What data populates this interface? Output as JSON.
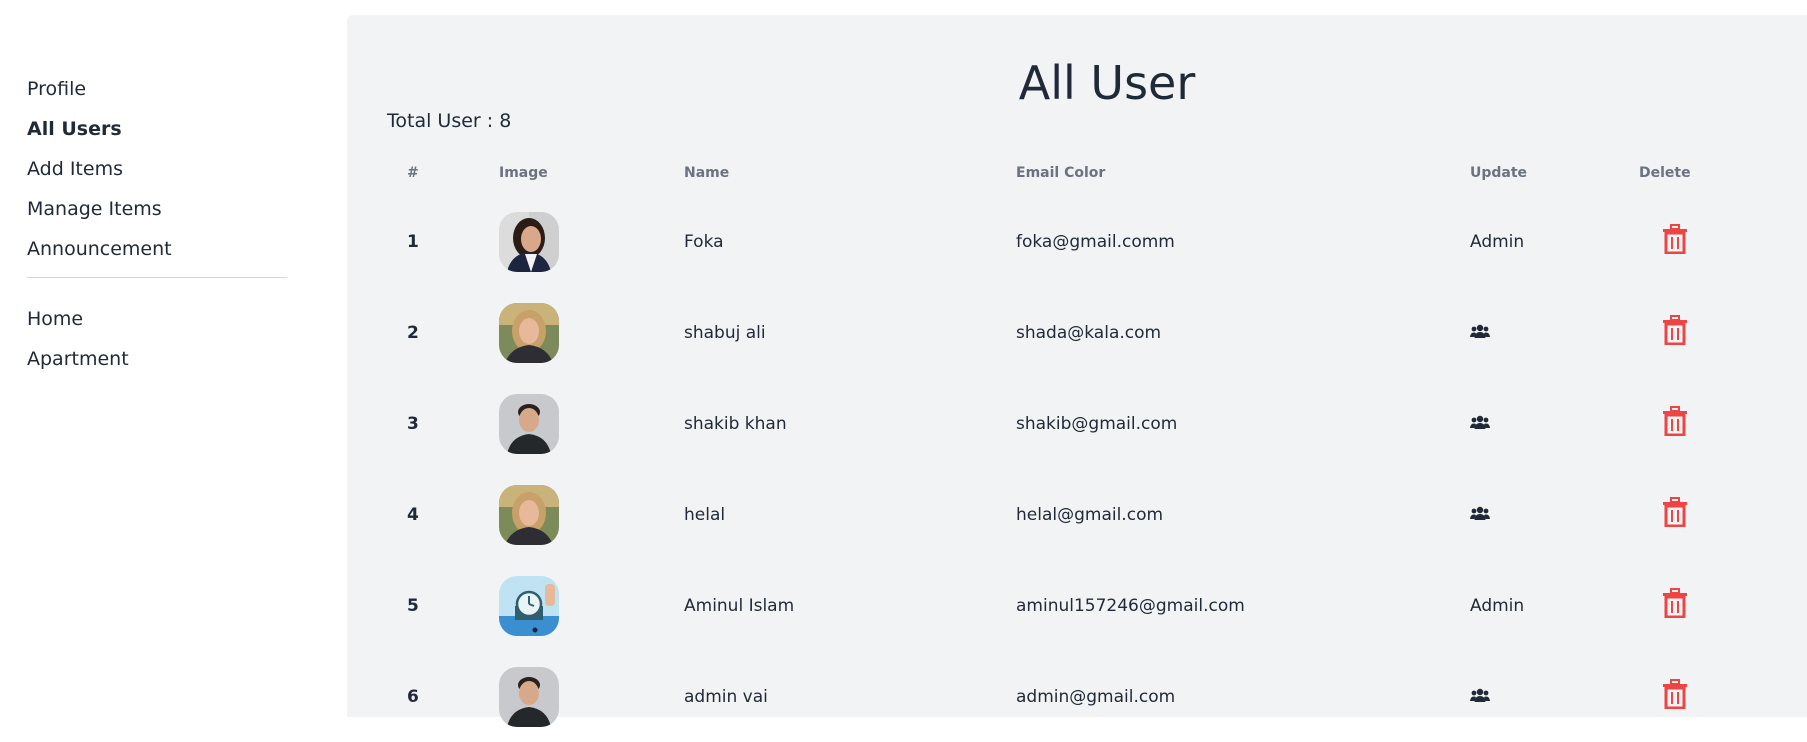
{
  "sidebar": {
    "primary": [
      {
        "label": "Profile"
      },
      {
        "label": "All Users"
      },
      {
        "label": "Add Items"
      },
      {
        "label": "Manage Items"
      },
      {
        "label": "Announcement"
      }
    ],
    "secondary": [
      {
        "label": "Home"
      },
      {
        "label": "Apartment"
      }
    ],
    "active": "All Users"
  },
  "main": {
    "title": "All User",
    "total_label": "Total User :",
    "total_count": "8"
  },
  "table": {
    "headers": [
      "#",
      "Image",
      "Name",
      "Email Color",
      "Update",
      "Delete"
    ],
    "rows": [
      {
        "index": "1",
        "name": "Foka",
        "email": "foka@gmail.comm",
        "role": "Admin",
        "avatar": "woman-dark-hair"
      },
      {
        "index": "2",
        "name": "shabuj ali",
        "email": "shada@kala.com",
        "role": "",
        "avatar": "woman-blonde"
      },
      {
        "index": "3",
        "name": "shakib khan",
        "email": "shakib@gmail.com",
        "role": "",
        "avatar": "man-dark-hair"
      },
      {
        "index": "4",
        "name": "helal",
        "email": "helal@gmail.com",
        "role": "",
        "avatar": "woman-blonde"
      },
      {
        "index": "5",
        "name": "Aminul Islam",
        "email": "aminul157246@gmail.com",
        "role": "Admin",
        "avatar": "clock-illustration"
      },
      {
        "index": "6",
        "name": "admin vai",
        "email": "admin@gmail.com",
        "role": "",
        "avatar": "man-dark-hair"
      }
    ]
  },
  "icons": {
    "make_admin": "users-icon",
    "delete": "trash-icon"
  },
  "colors": {
    "delete": "#ef4444",
    "main_bg": "#f2f3f5",
    "text": "#1f2937",
    "header_text": "#6b7280"
  }
}
